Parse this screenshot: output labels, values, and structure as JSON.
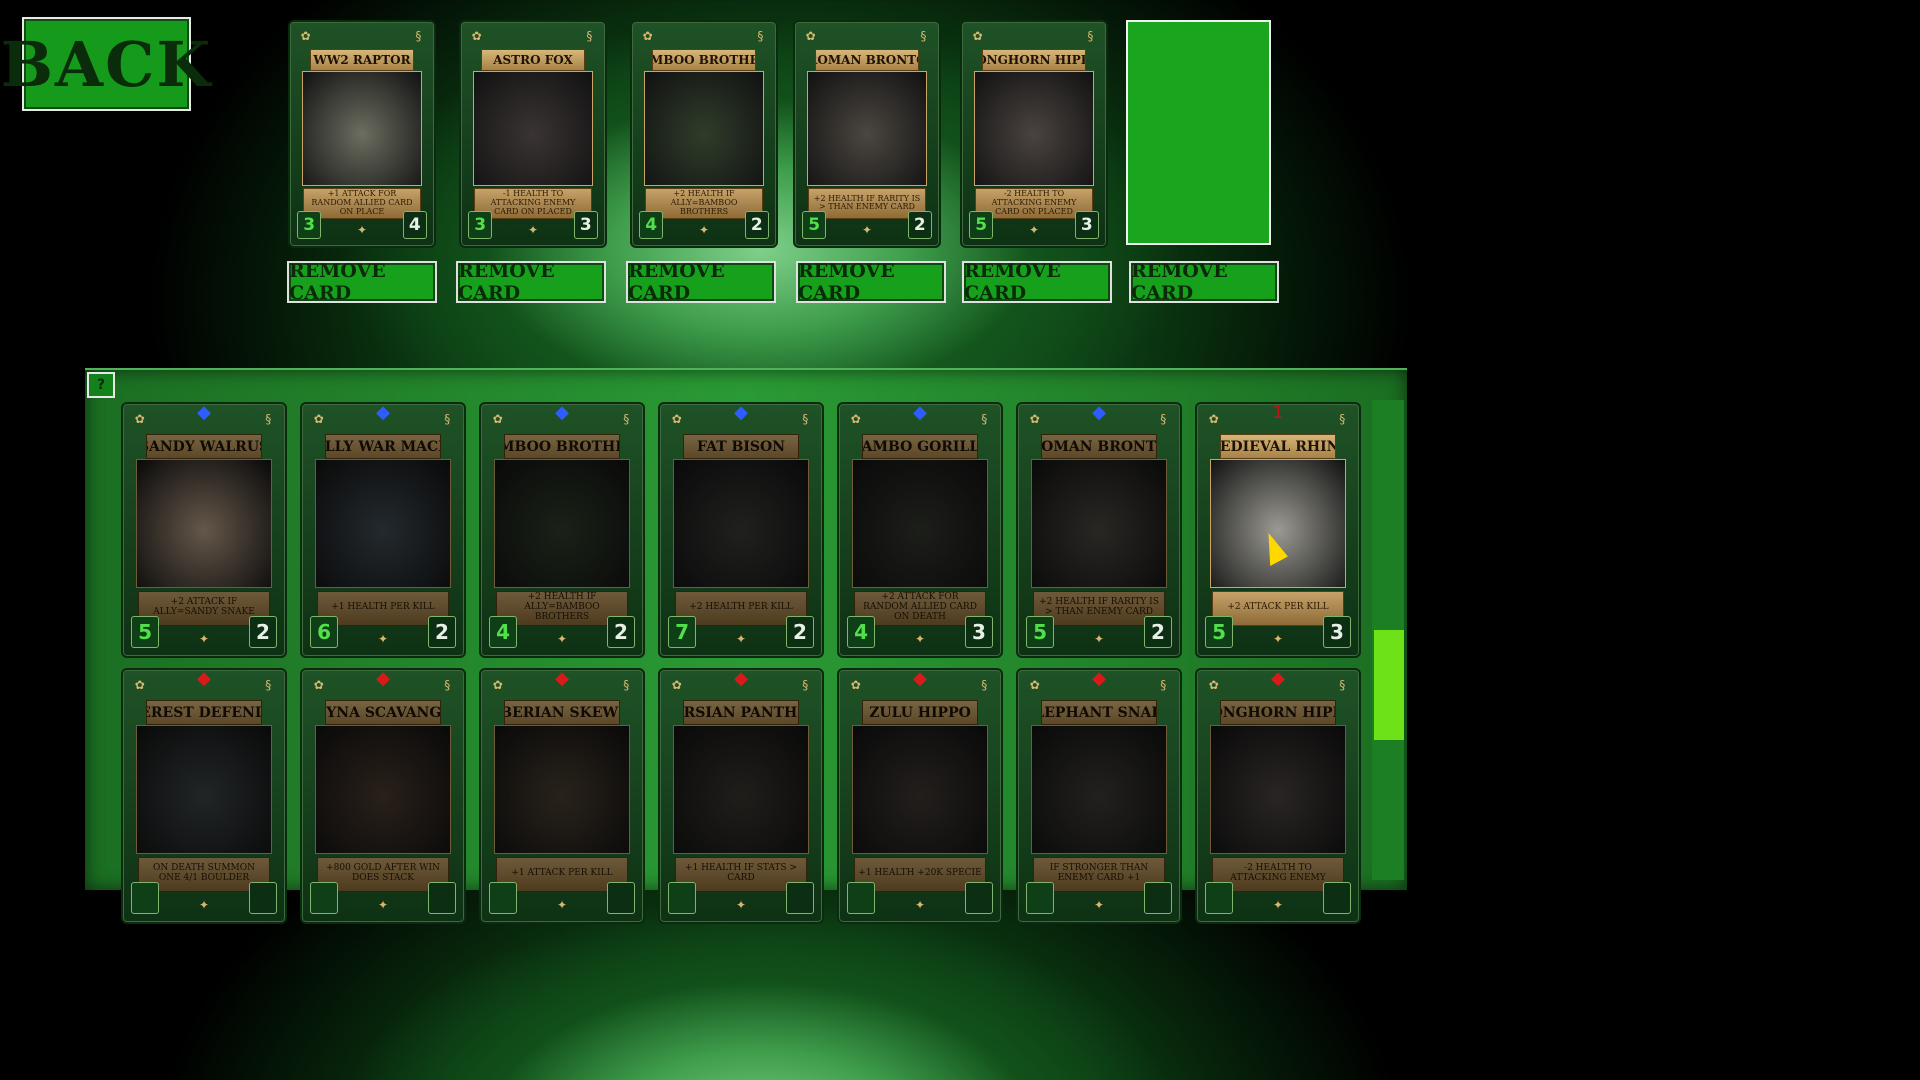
{
  "back_button": {
    "label": "BACK"
  },
  "deck": {
    "remove_label": "REMOVE CARD",
    "cards": [
      {
        "name": "WW2 RAPTOR",
        "desc": "+1 ATTACK FOR RANDOM ALLIED CARD ON PLACE",
        "attack": "3",
        "health": "4",
        "art": "#6b6e60"
      },
      {
        "name": "ASTRO FOX",
        "desc": "-1 HEALTH TO ATTACKING ENEMY CARD ON PLACED",
        "attack": "3",
        "health": "3",
        "art": "#3a3433"
      },
      {
        "name": "BAMBOO BROTHERS",
        "desc": "+2 HEALTH IF ALLY=BAMBOO BROTHERS",
        "attack": "4",
        "health": "2",
        "art": "#2f3d2a"
      },
      {
        "name": "ROMAN BRONTO",
        "desc": "+2 HEALTH IF RARITY IS > THAN ENEMY CARD",
        "attack": "5",
        "health": "2",
        "art": "#4b4640"
      },
      {
        "name": "LONGHORN HIPPO",
        "desc": "-2 HEALTH TO ATTACKING ENEMY CARD ON PLACED",
        "attack": "5",
        "health": "3",
        "art": "#4a4340"
      }
    ]
  },
  "collection": {
    "help_label": "?",
    "cards": [
      {
        "name": "SANDY WALRUS",
        "desc": "+2 ATTACK IF ALLY=SANDY SNAKE",
        "attack": "5",
        "health": "2",
        "gem": "blue",
        "gem_color": "#2f5cff",
        "art": "#b79e86"
      },
      {
        "name": "WOOLLY WAR MACHINE",
        "desc": "+1 HEALTH PER KILL",
        "attack": "6",
        "health": "2",
        "gem": "blue",
        "gem_color": "#2f5cff",
        "art": "#3f4b54"
      },
      {
        "name": "BAMBOO BROTHERS",
        "desc": "+2 HEALTH IF ALLY=BAMBOO BROTHERS",
        "attack": "4",
        "health": "2",
        "gem": "blue",
        "gem_color": "#2f5cff",
        "art": "#2f3d2a"
      },
      {
        "name": "FAT BISON",
        "desc": "+2 HEALTH PER KILL",
        "attack": "7",
        "health": "2",
        "gem": "blue",
        "gem_color": "#2f5cff",
        "art": "#3a3a38"
      },
      {
        "name": "RAMBO GORILLA",
        "desc": "+2 ATTACK FOR RANDOM ALLIED CARD ON DEATH",
        "attack": "4",
        "health": "3",
        "gem": "blue",
        "gem_color": "#2f5cff",
        "art": "#34372f"
      },
      {
        "name": "ROMAN BRONTO",
        "desc": "+2 HEALTH IF RARITY IS > THAN ENEMY CARD",
        "attack": "5",
        "health": "2",
        "gem": "blue",
        "gem_color": "#2f5cff",
        "art": "#4b4640"
      },
      {
        "name": "MEDIEVAL RHINO",
        "desc": "+2 ATTACK PER KILL",
        "attack": "5",
        "health": "3",
        "gem": "1",
        "gem_color": "#c0141a",
        "art": "#9b9a92"
      },
      {
        "name": "EVEREST DEFENDER",
        "desc": "ON DEATH SUMMON ONE 4/1 BOULDER",
        "attack": "",
        "health": "",
        "gem": "red",
        "gem_color": "#d81a1a",
        "art": "#3c4346"
      },
      {
        "name": "HEYNA SCAVANGER",
        "desc": "+800 GOLD AFTER WIN DOES STACK",
        "attack": "",
        "health": "",
        "gem": "red",
        "gem_color": "#d81a1a",
        "art": "#4a3a2e"
      },
      {
        "name": "SIBERIAN SKEWER",
        "desc": "+1 ATTACK PER KILL",
        "attack": "",
        "health": "",
        "gem": "red",
        "gem_color": "#d81a1a",
        "art": "#4a3e30"
      },
      {
        "name": "PERSIAN PANTHER",
        "desc": "+1 HEALTH IF STATS > CARD",
        "attack": "",
        "health": "",
        "gem": "red",
        "gem_color": "#d81a1a",
        "art": "#3a3630"
      },
      {
        "name": "ZULU HIPPO",
        "desc": "+1 HEALTH +20K SPECIE",
        "attack": "",
        "health": "",
        "gem": "red",
        "gem_color": "#d81a1a",
        "art": "#3e3733"
      },
      {
        "name": "ELEPHANT SNAKE",
        "desc": "IF STRONGER THAN ENEMY CARD +1",
        "attack": "",
        "health": "",
        "gem": "red",
        "gem_color": "#d81a1a",
        "art": "#3d3b36"
      },
      {
        "name": "LONGHORN HIPPO",
        "desc": "-2 HEALTH TO ATTACKING ENEMY",
        "attack": "",
        "health": "",
        "gem": "red",
        "gem_color": "#d81a1a",
        "art": "#4a4340"
      }
    ]
  }
}
